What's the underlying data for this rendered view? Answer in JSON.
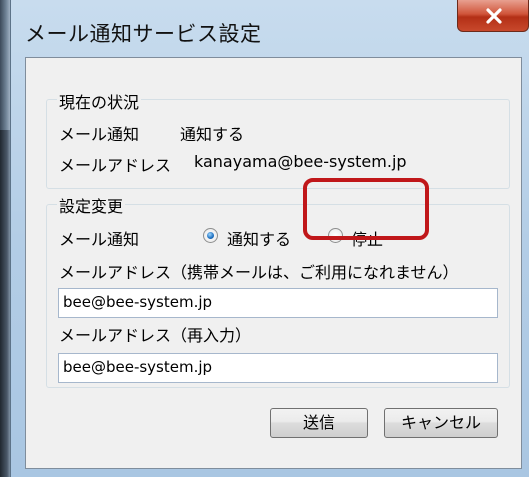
{
  "window": {
    "title": "メール通知サービス設定",
    "close_symbol": "X"
  },
  "status_group": {
    "legend": "現在の状況",
    "mail_notify_label": "メール通知",
    "mail_notify_value": "通知する",
    "mail_address_label": "メールアドレス",
    "mail_address_value": "kanayama@bee-system.jp"
  },
  "settings_group": {
    "legend": "設定変更",
    "mail_notify_label": "メール通知",
    "radio_notify_label": "通知する",
    "radio_stop_label": "停止",
    "selected": "通知する",
    "address_label": "メールアドレス（携帯メールは、ご利用になれません）",
    "address_value": "bee@bee-system.jp",
    "address_reenter_label": "メールアドレス（再入力）",
    "address_reenter_value": "bee@bee-system.jp"
  },
  "buttons": {
    "send": "送信",
    "cancel": "キャンセル"
  },
  "colors": {
    "highlight": "#c0171a",
    "close_button": "#c8492c",
    "frame": "#b3cde6"
  }
}
